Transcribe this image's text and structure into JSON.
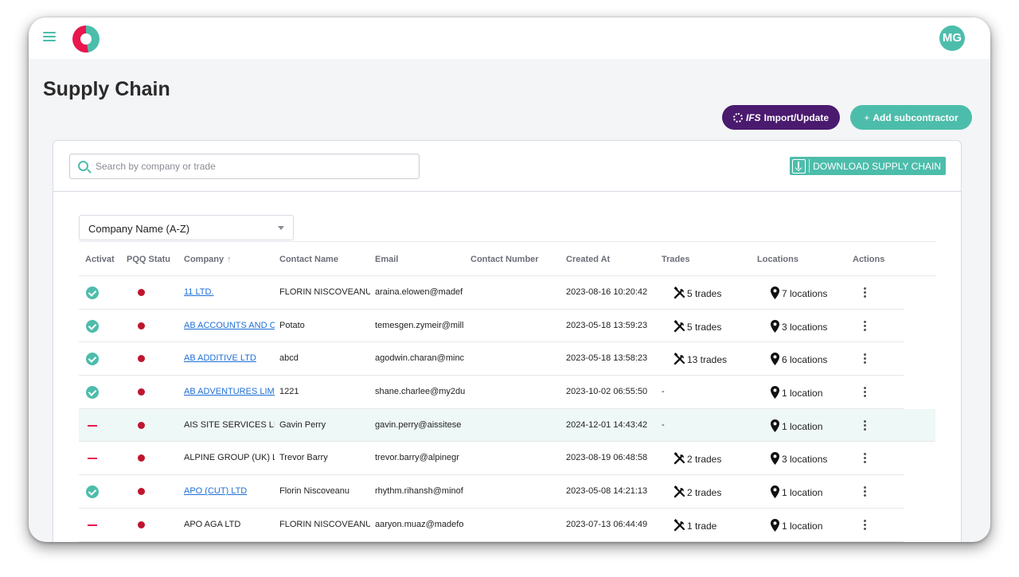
{
  "header": {
    "avatar_initials": "MG"
  },
  "page": {
    "title": "Supply Chain"
  },
  "actions": {
    "ifs_mark": "IFS",
    "import_label": "Import/Update",
    "add_label": "Add subcontractor",
    "add_prefix": "+"
  },
  "search": {
    "placeholder": "Search by company or trade",
    "value": ""
  },
  "download": {
    "label": "DOWNLOAD SUPPLY CHAIN"
  },
  "sort": {
    "selected": "Company Name (A-Z)"
  },
  "table": {
    "columns": [
      "Activat",
      "PQQ Statu",
      "Company",
      "Contact Name",
      "Email",
      "Contact Number",
      "Created At",
      "Trades",
      "Locations",
      "Actions"
    ],
    "sorted_column_arrow": "↑",
    "rows": [
      {
        "active": true,
        "company": "11 LTD.",
        "company_link": true,
        "contact": "FLORIN NISCOVEANU",
        "email": "araina.elowen@madef",
        "phone": "",
        "created": "2023-08-16 10:20:42",
        "trades": "5 trades",
        "locations": "7 locations"
      },
      {
        "active": true,
        "company": "AB ACCOUNTS AND C",
        "company_link": true,
        "contact": "Potato",
        "email": "temesgen.zymeir@mill",
        "phone": "",
        "created": "2023-05-18 13:59:23",
        "trades": "5 trades",
        "locations": "3 locations"
      },
      {
        "active": true,
        "company": "AB ADDITIVE LTD",
        "company_link": true,
        "contact": "abcd",
        "email": "agodwin.charan@minc",
        "phone": "",
        "created": "2023-05-18 13:58:23",
        "trades": "13 trades",
        "locations": "6 locations"
      },
      {
        "active": true,
        "company": "AB ADVENTURES LIMI",
        "company_link": true,
        "contact": "1221",
        "email": "shane.charlee@my2du",
        "phone": "",
        "created": "2023-10-02 06:55:50",
        "trades": "-",
        "locations": "1 location"
      },
      {
        "active": false,
        "company": "AIS SITE SERVICES LIM",
        "company_link": false,
        "contact": "Gavin Perry",
        "email": "gavin.perry@aissitese",
        "phone": "",
        "created": "2024-12-01 14:43:42",
        "trades": "-",
        "locations": "1 location",
        "highlight": true
      },
      {
        "active": false,
        "company": "ALPINE GROUP (UK) L",
        "company_link": false,
        "contact": "Trevor Barry",
        "email": "trevor.barry@alpinegr",
        "phone": "",
        "created": "2023-08-19 06:48:58",
        "trades": "2 trades",
        "locations": "3 locations"
      },
      {
        "active": true,
        "company": "APO (CUT) LTD",
        "company_link": true,
        "contact": "Florin Niscoveanu",
        "email": "rhythm.rihansh@minof",
        "phone": "",
        "created": "2023-05-08 14:21:13",
        "trades": "2 trades",
        "locations": "1 location"
      },
      {
        "active": false,
        "company": "APO AGA LTD",
        "company_link": false,
        "contact": "FLORIN NISCOVEANU",
        "email": "aaryon.muaz@madefo",
        "phone": "",
        "created": "2023-07-13 06:44:49",
        "trades": "1 trade",
        "locations": "1 location"
      }
    ]
  },
  "colors": {
    "accent": "#4dbdab",
    "brand_purple": "#4a1a6e",
    "inactive": "#e8174e",
    "pqq_status": "#c0152f",
    "link": "#1f6fd6"
  }
}
